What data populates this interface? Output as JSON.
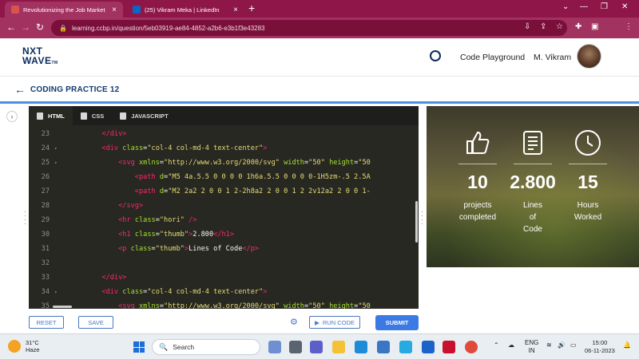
{
  "browser": {
    "tabs": [
      {
        "title": "Revolutionizing the Job Market |",
        "active": true,
        "favicon_color": "#d9534f"
      },
      {
        "title": "(25) Vikram Meka | LinkedIn",
        "active": false,
        "favicon_color": "#0a66c2"
      }
    ],
    "new_tab": "+",
    "url": "learning.ccbp.in/question/5eb03919-ae84-4852-a2b6-e3b1f3e43283"
  },
  "header": {
    "logo_line1": "NXT",
    "logo_line2": "WAVE",
    "logo_tm": "TM",
    "playground": "Code Playground",
    "user": "M. Vikram"
  },
  "page": {
    "title": "CODING PRACTICE 12"
  },
  "editor": {
    "tabs": [
      {
        "label": "HTML",
        "icon": "html5-icon",
        "active": true
      },
      {
        "label": "CSS",
        "icon": "css3-icon",
        "active": false
      },
      {
        "label": "JAVASCRIPT",
        "icon": "js-file-icon",
        "active": false
      }
    ],
    "lines": [
      {
        "n": "23",
        "fold": "",
        "indent": "        ",
        "html": "<span class=\"tg\">&lt;/div&gt;</span>"
      },
      {
        "n": "24",
        "fold": "▾",
        "indent": "        ",
        "html": "<span class=\"tg\">&lt;div</span> <span class=\"at\">class</span>=<span class=\"st\">\"col-4 col-md-4 text-center\"</span><span class=\"tg\">&gt;</span>"
      },
      {
        "n": "25",
        "fold": "▾",
        "indent": "            ",
        "html": "<span class=\"tg\">&lt;svg</span> <span class=\"at\">xmlns</span>=<span class=\"st\">\"http://www.w3.org/2000/svg\"</span> <span class=\"at\">width</span>=<span class=\"st\">\"50\"</span> <span class=\"at\">height</span>=<span class=\"st\">\"50</span>"
      },
      {
        "n": "26",
        "fold": "",
        "indent": "                ",
        "html": "<span class=\"tg\">&lt;path</span> <span class=\"at\">d</span>=<span class=\"st\">\"M5 4a.5.5 0 0 0 0 1h6a.5.5 0 0 0 0-1H5zm-.5 2.5A</span>"
      },
      {
        "n": "27",
        "fold": "",
        "indent": "                ",
        "html": "<span class=\"tg\">&lt;path</span> <span class=\"at\">d</span>=<span class=\"st\">\"M2 2a2 2 0 0 1 2-2h8a2 2 0 0 1 2 2v12a2 2 0 0 1-</span>"
      },
      {
        "n": "28",
        "fold": "",
        "indent": "            ",
        "html": "<span class=\"tg\">&lt;/svg&gt;</span>"
      },
      {
        "n": "29",
        "fold": "",
        "indent": "            ",
        "html": "<span class=\"tg\">&lt;hr</span> <span class=\"at\">class</span>=<span class=\"st\">\"hori\"</span> <span class=\"tg\">/&gt;</span>"
      },
      {
        "n": "30",
        "fold": "",
        "indent": "            ",
        "html": "<span class=\"tg\">&lt;h1</span> <span class=\"at\">class</span>=<span class=\"st\">\"thumb\"</span><span class=\"tg\">&gt;</span>2.800<span class=\"tg\">&lt;/h1&gt;</span>"
      },
      {
        "n": "31",
        "fold": "",
        "indent": "            ",
        "html": "<span class=\"tg\">&lt;p</span> <span class=\"at\">class</span>=<span class=\"st\">\"thumb\"</span><span class=\"tg\">&gt;</span>Lines of Code<span class=\"tg\">&lt;/p&gt;</span>"
      },
      {
        "n": "32",
        "fold": "",
        "indent": "",
        "html": ""
      },
      {
        "n": "33",
        "fold": "",
        "indent": "        ",
        "html": "<span class=\"tg\">&lt;/div&gt;</span>"
      },
      {
        "n": "34",
        "fold": "▾",
        "indent": "        ",
        "html": "<span class=\"tg\">&lt;div</span> <span class=\"at\">class</span>=<span class=\"st\">\"col-4 col-md-4 text-center\"</span><span class=\"tg\">&gt;</span>"
      },
      {
        "n": "35",
        "fold": "▾",
        "indent": "            ",
        "html": "<span class=\"tg\">&lt;svg</span> <span class=\"at\">xmlns</span>=<span class=\"st\">\"http://www.w3.org/2000/svg\"</span> <span class=\"at\">width</span>=<span class=\"st\">\"50\"</span> <span class=\"at\">height</span>=<span class=\"st\">\"50</span>"
      }
    ]
  },
  "actions": {
    "reset": "RESET",
    "save": "SAVE",
    "run": "RUN CODE",
    "submit": "SUBMIT"
  },
  "preview": {
    "stats": [
      {
        "icon": "thumbs-up-icon",
        "value": "10",
        "label": [
          "projects",
          "completed"
        ]
      },
      {
        "icon": "document-icon",
        "value": "2.800",
        "label": [
          "Lines",
          "of",
          "Code"
        ]
      },
      {
        "icon": "clock-icon",
        "value": "15",
        "label": [
          "Hours",
          "Worked"
        ]
      }
    ]
  },
  "taskbar": {
    "temp": "31°C",
    "weather": "Haze",
    "search": "Search",
    "lang1": "ENG",
    "lang2": "IN",
    "time": "15:00",
    "date": "06-11-2023"
  }
}
